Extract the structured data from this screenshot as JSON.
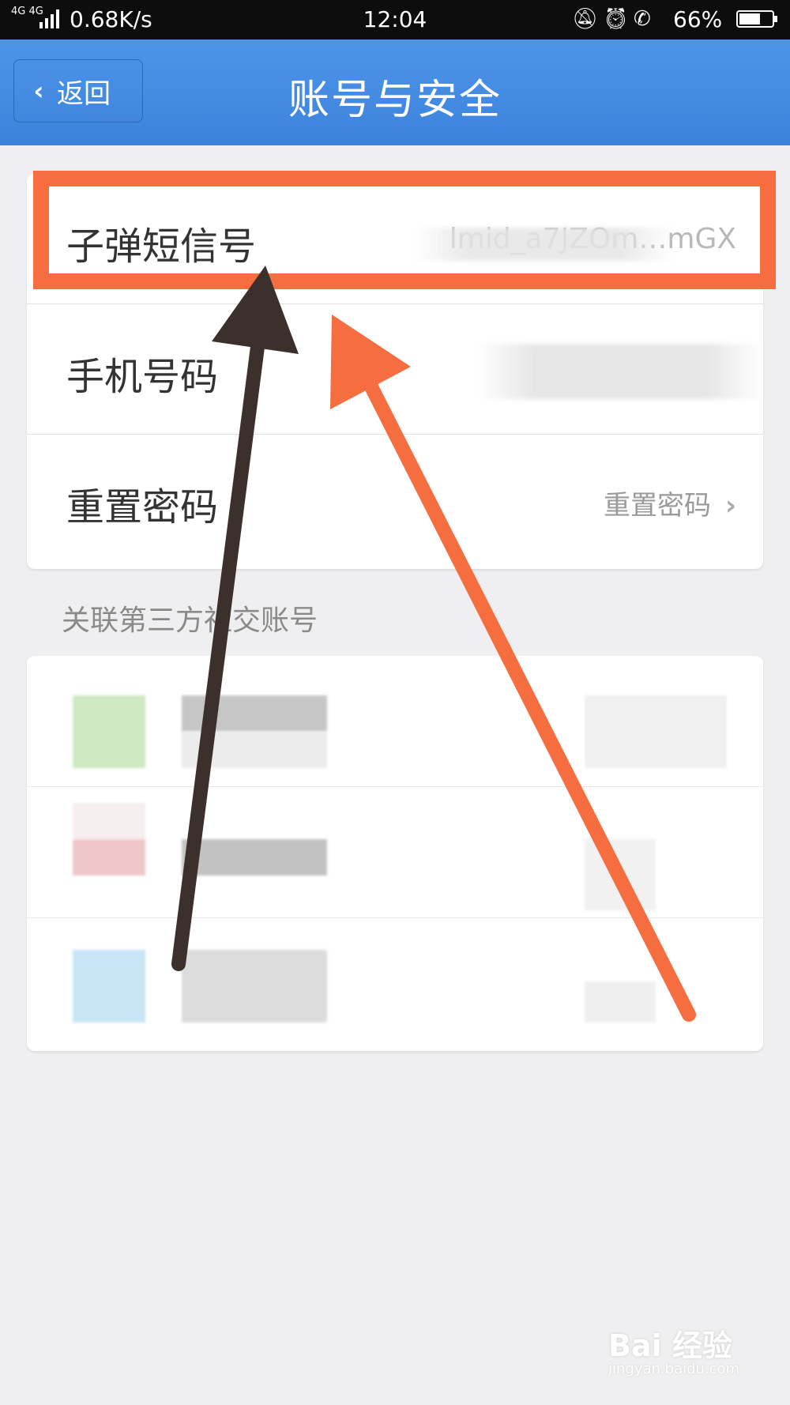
{
  "status_bar": {
    "network": "4G 4G",
    "speed": "0.68K/s",
    "time": "12:04",
    "icons": [
      "mute-icon",
      "alarm-icon",
      "hd-call-icon"
    ],
    "battery": "66%",
    "battery_level": 0.66
  },
  "nav": {
    "back_label": "返回",
    "title": "账号与安全"
  },
  "account": {
    "rows": [
      {
        "label": "子弹短信号",
        "value": "lmid_a7JZOm…mGX"
      },
      {
        "label": "手机号码",
        "value": ""
      },
      {
        "label": "重置密码",
        "value": "重置密码"
      }
    ]
  },
  "social": {
    "section_title": "关联第三方社交账号"
  },
  "colors": {
    "nav_blue": "#3f86df",
    "highlight_orange": "#f66e3f",
    "arrow_dark": "#3b302c"
  },
  "watermark": {
    "brand": "Bai 经验",
    "site": "jingyan.baidu.com"
  }
}
